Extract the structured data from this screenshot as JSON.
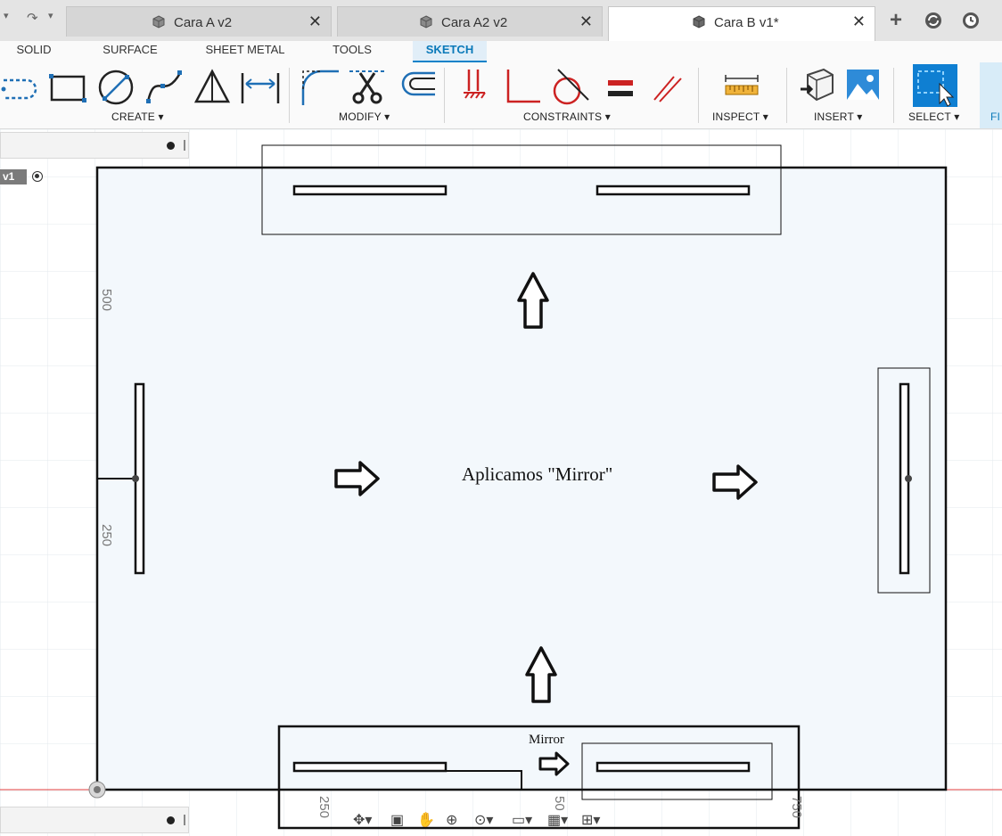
{
  "tabs": [
    {
      "label": "Cara A v2",
      "active": false
    },
    {
      "label": "Cara A2 v2",
      "active": false
    },
    {
      "label": "Cara B v1*",
      "active": true
    }
  ],
  "tab_close_glyph": "✕",
  "top_icons": [
    "add-tab-icon",
    "online-status-icon",
    "job-status-icon"
  ],
  "workspace_tabs": [
    "SOLID",
    "SURFACE",
    "SHEET METAL",
    "TOOLS",
    "SKETCH"
  ],
  "active_workspace": "SKETCH",
  "toolbar_groups": [
    {
      "label": "CREATE ▾",
      "icons": [
        "slot-icon",
        "rectangle-icon",
        "circle-icon",
        "spline-icon",
        "triangle-icon",
        "dimension-icon"
      ]
    },
    {
      "label": "MODIFY ▾",
      "icons": [
        "fillet-icon",
        "trim-icon",
        "offset-icon"
      ]
    },
    {
      "label": "CONSTRAINTS ▾",
      "icons": [
        "coincident-icon",
        "perpendicular-icon",
        "tangent-icon",
        "equal-icon",
        "parallel-icon"
      ]
    },
    {
      "label": "INSPECT ▾",
      "icons": [
        "measure-icon"
      ]
    },
    {
      "label": "INSERT ▾",
      "icons": [
        "insert-derive-icon",
        "insert-image-icon"
      ]
    },
    {
      "label": "SELECT ▾",
      "icons": [
        "select-icon"
      ]
    },
    {
      "label": "FI",
      "icons": []
    }
  ],
  "browser": {
    "component_label": "v1"
  },
  "dimensions": {
    "y_500": "500",
    "y_250": "250",
    "x_250": "250",
    "x_500": "50",
    "x_750": "750"
  },
  "annotations": {
    "main_text": "Aplicamos \"Mirror\"",
    "mirror_label": "Mirror"
  },
  "colors": {
    "accent": "#0b82c9",
    "sketch_fill": "#f3f8fc",
    "x_axis": "#e03c3c",
    "grid": "#e3e9ee"
  }
}
